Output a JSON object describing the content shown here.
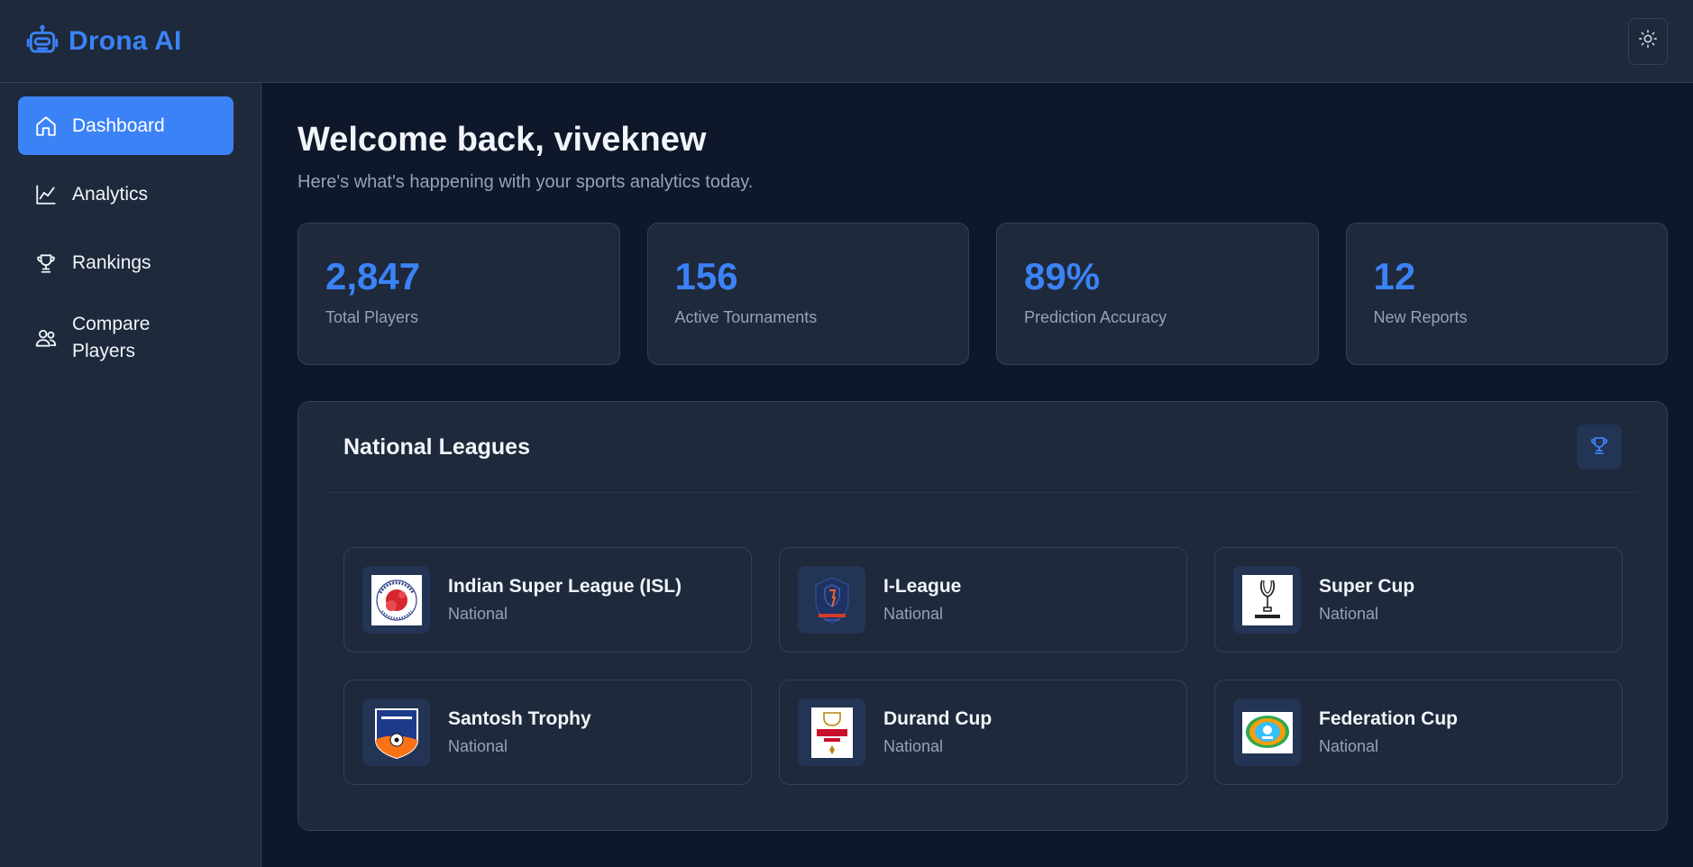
{
  "app": {
    "brand_name": "Drona AI",
    "brand_icon": "robot-icon",
    "theme_toggle_icon": "sun-icon",
    "accent_color": "#3b82f6"
  },
  "sidebar": {
    "items": [
      {
        "label": "Dashboard",
        "icon": "home-icon",
        "active": true
      },
      {
        "label": "Analytics",
        "icon": "line-chart-icon",
        "active": false
      },
      {
        "label": "Rankings",
        "icon": "trophy-icon",
        "active": false
      },
      {
        "label": "Compare Players",
        "icon": "users-icon",
        "active": false
      }
    ]
  },
  "main": {
    "welcome": "Welcome back, viveknew",
    "subtitle": "Here's what's happening with your sports analytics today.",
    "stats": [
      {
        "value": "2,847",
        "label": "Total Players"
      },
      {
        "value": "156",
        "label": "Active Tournaments"
      },
      {
        "value": "89%",
        "label": "Prediction Accuracy"
      },
      {
        "value": "12",
        "label": "New Reports"
      }
    ],
    "leagues_panel": {
      "title": "National Leagues",
      "header_icon": "trophy-icon",
      "leagues": [
        {
          "name": "Indian Super League (ISL)",
          "type": "National",
          "logo": "isl-logo"
        },
        {
          "name": "I-League",
          "type": "National",
          "logo": "i-league-logo"
        },
        {
          "name": "Super Cup",
          "type": "National",
          "logo": "super-cup-logo"
        },
        {
          "name": "Santosh Trophy",
          "type": "National",
          "logo": "santosh-trophy-logo"
        },
        {
          "name": "Durand Cup",
          "type": "National",
          "logo": "durand-cup-logo"
        },
        {
          "name": "Federation Cup",
          "type": "National",
          "logo": "federation-cup-logo"
        }
      ]
    }
  }
}
